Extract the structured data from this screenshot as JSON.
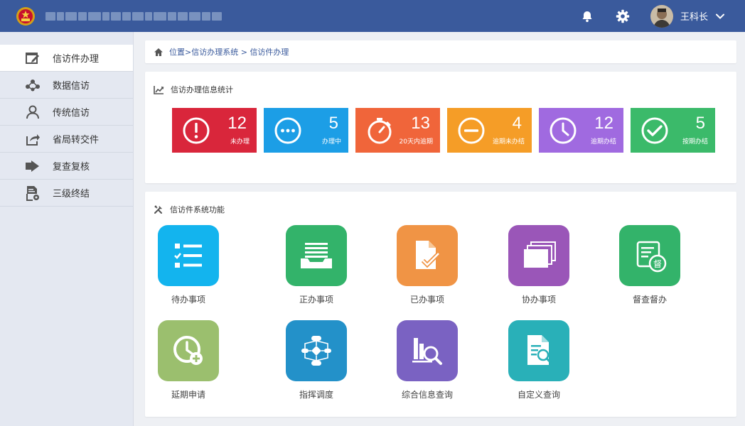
{
  "header": {
    "user_name": "王科长",
    "icons": [
      "emblem-icon",
      "bell-icon",
      "gear-icon",
      "avatar",
      "chevron-down-icon"
    ]
  },
  "sidebar": {
    "items": [
      {
        "label": "信访件办理",
        "icon": "edit-window-icon",
        "active": true
      },
      {
        "label": "数据信访",
        "icon": "network-icon",
        "active": false
      },
      {
        "label": "传统信访",
        "icon": "person-icon",
        "active": false
      },
      {
        "label": "省局转交件",
        "icon": "share-icon",
        "active": false
      },
      {
        "label": "复查复核",
        "icon": "arrow-right-icon",
        "active": false
      },
      {
        "label": "三级终结",
        "icon": "document-gear-icon",
        "active": false
      }
    ]
  },
  "breadcrumb": {
    "prefix": "位置>",
    "path1": "信访办理系统",
    "sep": " > ",
    "path2": "信访件办理"
  },
  "stats": {
    "title": "信访办理信息统计",
    "cards": [
      {
        "value": "12",
        "label": "未办理",
        "color": "#d9263b",
        "icon": "alert-circle-icon"
      },
      {
        "value": "5",
        "label": "办理中",
        "color": "#1c9ee6",
        "icon": "more-circle-icon"
      },
      {
        "value": "13",
        "label": "20天内逾期",
        "color": "#f0653a",
        "icon": "stopwatch-icon"
      },
      {
        "value": "4",
        "label": "逾期未办结",
        "color": "#f59d27",
        "icon": "minus-circle-icon"
      },
      {
        "value": "12",
        "label": "逾期办结",
        "color": "#a06ae0",
        "icon": "clock-icon"
      },
      {
        "value": "5",
        "label": "按期办结",
        "color": "#3bba6a",
        "icon": "check-circle-icon"
      }
    ]
  },
  "functions": {
    "title": "信访件系统功能",
    "items": [
      {
        "label": "待办事项",
        "color": "#13b4ee",
        "icon": "checklist-icon"
      },
      {
        "label": "正办事项",
        "color": "#33b36a",
        "icon": "inbox-tray-icon"
      },
      {
        "label": "已办事项",
        "color": "#f09445",
        "icon": "document-check-icon"
      },
      {
        "label": "协办事项",
        "color": "#9a56b8",
        "icon": "stacked-windows-icon"
      },
      {
        "label": "督查督办",
        "color": "#33b36a",
        "icon": "supervise-document-icon"
      },
      {
        "label": "延期申请",
        "color": "#9bbf6e",
        "icon": "clock-plus-icon"
      },
      {
        "label": "指挥调度",
        "color": "#2391c9",
        "icon": "flowchart-icon"
      },
      {
        "label": "综合信息查询",
        "color": "#7a62c2",
        "icon": "chart-search-icon"
      },
      {
        "label": "自定义查询",
        "color": "#29b0b8",
        "icon": "document-search-icon"
      }
    ],
    "badge_text": "督"
  }
}
